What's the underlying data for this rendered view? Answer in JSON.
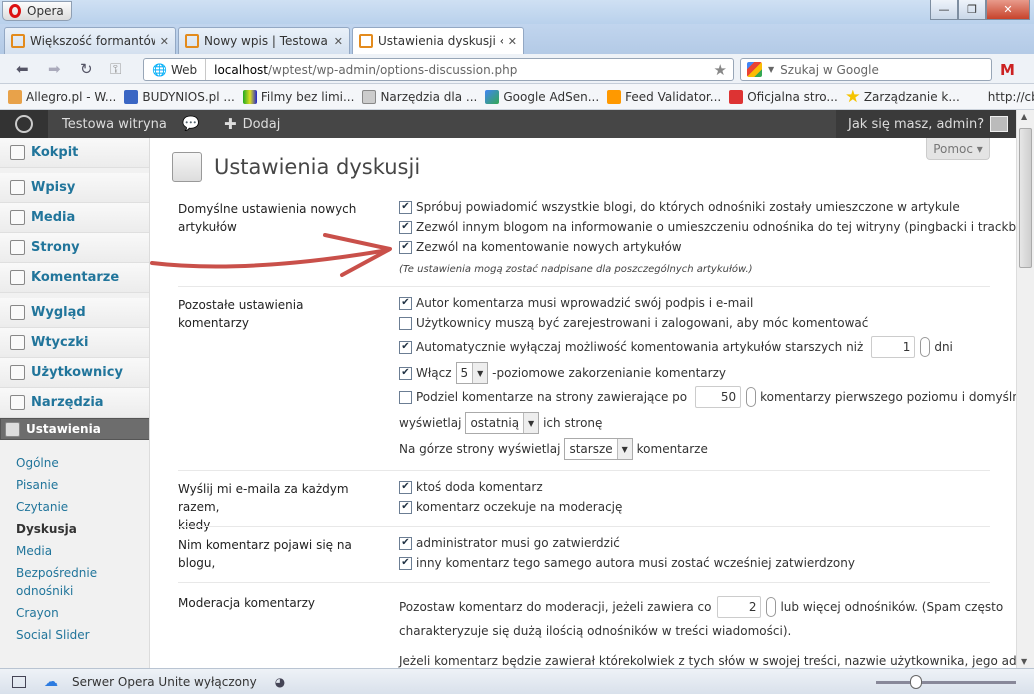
{
  "browser": {
    "menu_label": "Opera",
    "tabs": [
      {
        "label": "Większość formantów ..."
      },
      {
        "label": "Nowy wpis | Testowa w..."
      },
      {
        "label": "Ustawienia dyskusji ‹ T..."
      }
    ],
    "address": {
      "scheme_label": "Web",
      "host": "localhost",
      "path": "/wptest/wp-admin/options-discussion.php"
    },
    "search_placeholder": "Szukaj w Google",
    "bookmarks": [
      "Allegro.pl - W...",
      "BUDYNIOS.pl ...",
      "Filmy bez limi...",
      "Narzędzia dla ...",
      "Google AdSen...",
      "Feed Validator...",
      "Oficjalna stro...",
      "Zarządzanie k...",
      "http://cba.pl/..."
    ]
  },
  "adminbar": {
    "site_name": "Testowa witryna",
    "add_label": "Dodaj",
    "greeting": "Jak się masz, admin?"
  },
  "sidebar": {
    "items": [
      "Kokpit",
      "Wpisy",
      "Media",
      "Strony",
      "Komentarze",
      "Wygląd",
      "Wtyczki",
      "Użytkownicy",
      "Narzędzia",
      "Ustawienia"
    ],
    "submenu": [
      "Ogólne",
      "Pisanie",
      "Czytanie",
      "Dyskusja",
      "Media",
      "Bezpośrednie",
      "odnośniki",
      "Crayon",
      "Social Slider"
    ]
  },
  "page": {
    "title": "Ustawienia dyskusji",
    "help_label": "Pomoc ▾"
  },
  "sections": {
    "default_label_1": "Domyślne ustawienia nowych",
    "default_label_2": "artykułów",
    "default_opts": [
      "Spróbuj powiadomić wszystkie blogi, do których odnośniki zostały umieszczone w artykule",
      "Zezwól innym blogom na informowanie o umieszczeniu odnośnika do tej witryny (pingbacki i trackbacki)",
      "Zezwól na komentowanie nowych artykułów"
    ],
    "default_note": "(Te ustawienia mogą zostać nadpisane dla poszczególnych artykułów.)",
    "other_label": "Pozostałe ustawienia komentarzy",
    "other_1": "Autor komentarza musi wprowadzić swój podpis i e-mail",
    "other_2": "Użytkownicy muszą być zarejestrowani i zalogowani, aby móc komentować",
    "other_3a": "Automatycznie wyłączaj możliwość komentowania artykułów starszych niż",
    "other_3_value": "1",
    "other_3b": "dni",
    "other_4a": "Włącz",
    "other_4_value": "5",
    "other_4b": "-poziomowe zakorzenianie komentarzy",
    "other_5a": "Podziel komentarze na strony zawierające po",
    "other_5_value": "50",
    "other_5b": "komentarzy pierwszego poziomu i domyślnie",
    "other_6a": "wyświetlaj",
    "other_6_value": "ostatnią",
    "other_6b": "ich stronę",
    "other_7a": "Na górze strony wyświetlaj",
    "other_7_value": "starsze",
    "other_7b": "komentarze",
    "email_label_1": "Wyślij mi e-maila za każdym razem,",
    "email_label_2": "kiedy",
    "email_1": "ktoś doda komentarz",
    "email_2": "komentarz oczekuje na moderację",
    "before_label": "Nim komentarz pojawi się na blogu,",
    "before_1": "administrator musi go zatwierdzić",
    "before_2": "inny komentarz tego samego autora musi zostać wcześniej zatwierdzony",
    "mod_label": "Moderacja komentarzy",
    "mod_1a": "Pozostaw komentarz do moderacji, jeżeli zawiera co",
    "mod_1_value": "2",
    "mod_1b": "lub więcej odnośników. (Spam często",
    "mod_2": "charakteryzuje się dużą ilością odnośników w treści wiadomości).",
    "mod_3": "Jeżeli komentarz będzie zawierał którekolwiek z tych słów w swojej treści, nazwie użytkownika, jego adresie"
  },
  "status": {
    "unite": "Serwer Opera Unite wyłączony"
  }
}
